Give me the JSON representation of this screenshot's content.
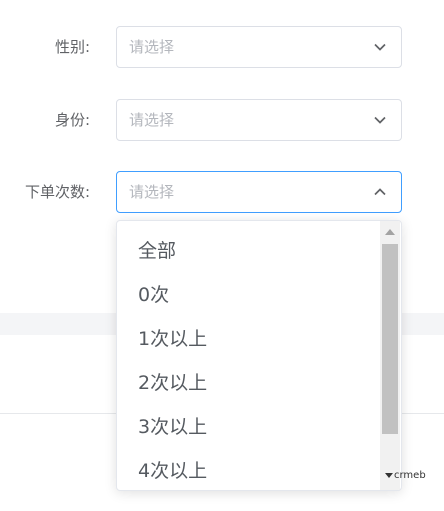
{
  "form": {
    "fields": [
      {
        "label": "性别:",
        "placeholder": "请选择"
      },
      {
        "label": "身份:",
        "placeholder": "请选择"
      },
      {
        "label": "下单次数:",
        "placeholder": "请选择"
      }
    ]
  },
  "dropdown": {
    "options": [
      "全部",
      "0次",
      "1次以上",
      "2次以上",
      "3次以上",
      "4次以上"
    ]
  },
  "watermark": {
    "text": "crmeb"
  },
  "colors": {
    "focus_border": "#409eff",
    "border": "#dcdfe6",
    "label": "#606266",
    "placeholder": "#b4b7bd"
  }
}
